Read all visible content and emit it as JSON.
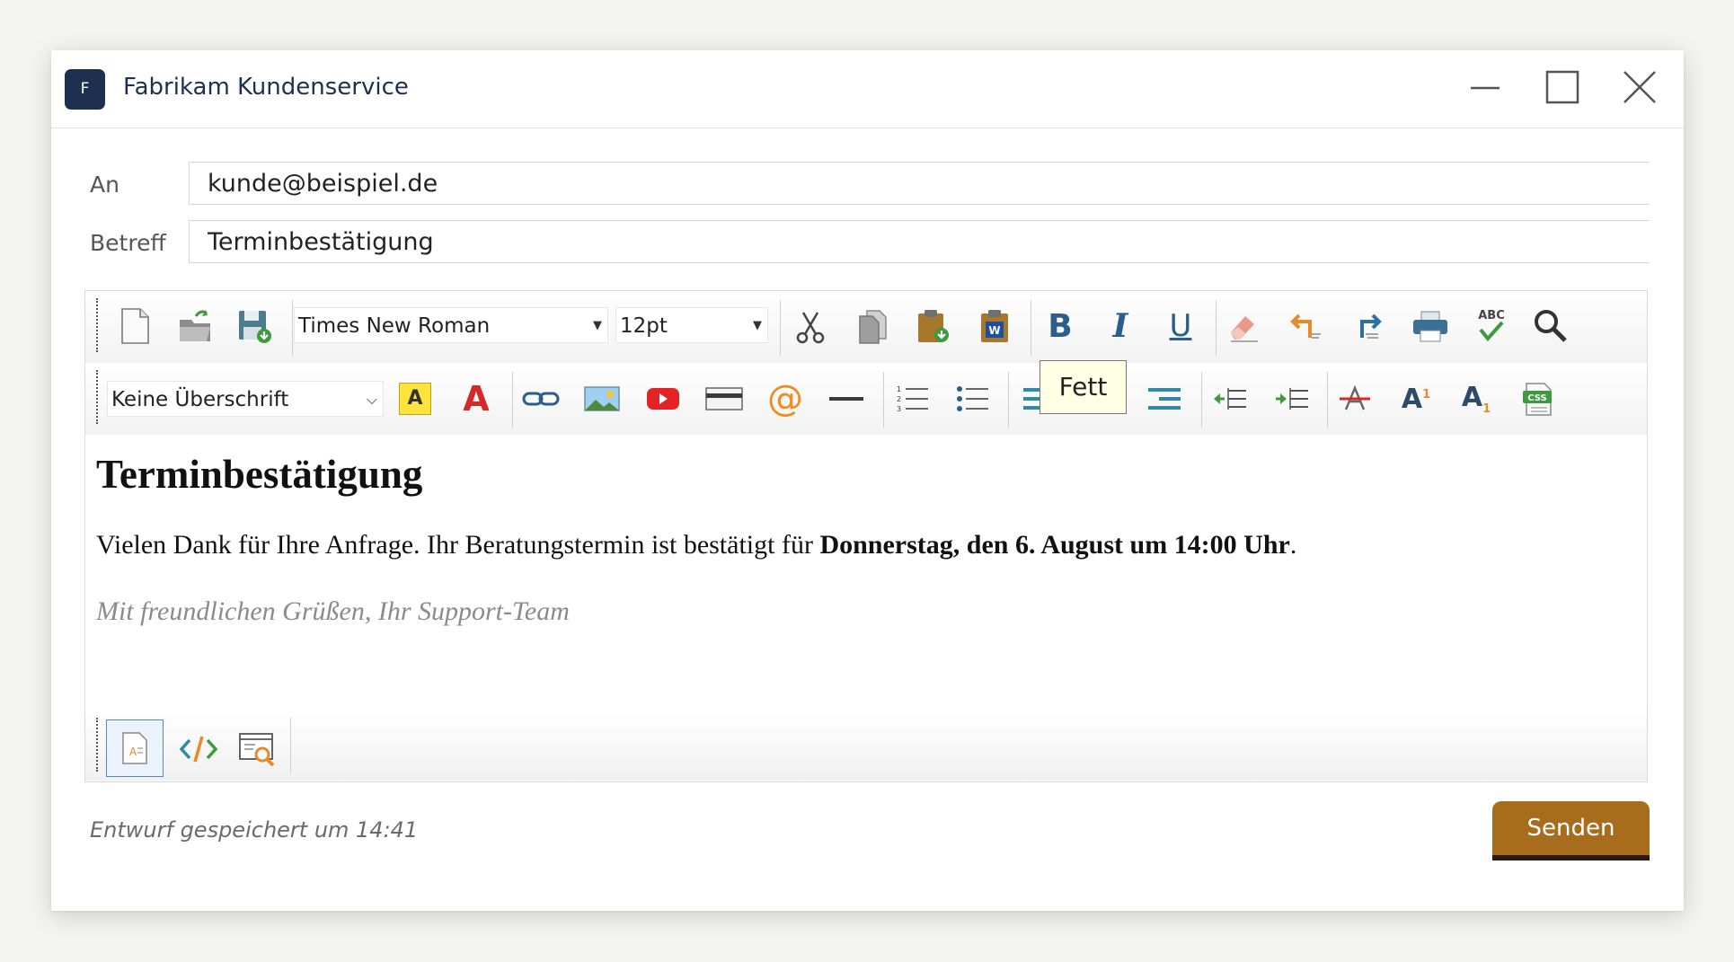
{
  "app": {
    "icon_letter": "F",
    "title": "Fabrikam Kundenservice"
  },
  "window_controls": {
    "minimize": "minimize-icon",
    "maximize": "maximize-icon",
    "close": "close-icon"
  },
  "compose": {
    "to_label": "An",
    "to_value": "kunde@beispiel.de",
    "subject_label": "Betreff",
    "subject_value": "Terminbestätigung"
  },
  "toolbar": {
    "font_family": "Times New Roman",
    "font_size": "12pt",
    "heading_style": "Keine Überschrift",
    "tooltip": "Fett",
    "bold_glyph": "B",
    "italic_glyph": "I",
    "underline_glyph": "U",
    "abc_glyph": "ABC",
    "highlight_glyph": "A",
    "fontcolor_glyph": "A",
    "superscript_glyph": "A",
    "superscript_index": "1",
    "subscript_glyph": "A",
    "subscript_index": "1",
    "at_glyph": "@",
    "css_glyph": "CSS",
    "word_glyph": "W"
  },
  "body": {
    "heading": "Terminbestätigung",
    "para_prefix": "Vielen Dank für Ihre Anfrage. Ihr Beratungstermin ist bestätigt für ",
    "para_bold": "Donnerstag, den 6. August um 14:00 Uhr",
    "para_suffix": ".",
    "signature": "Mit freundlichen Grüßen, Ihr Support-Team"
  },
  "footer": {
    "status": "Entwurf gespeichert um 14:41",
    "send_label": "Senden"
  },
  "colors": {
    "brand": "#1d3050",
    "send": "#a86c1d"
  }
}
